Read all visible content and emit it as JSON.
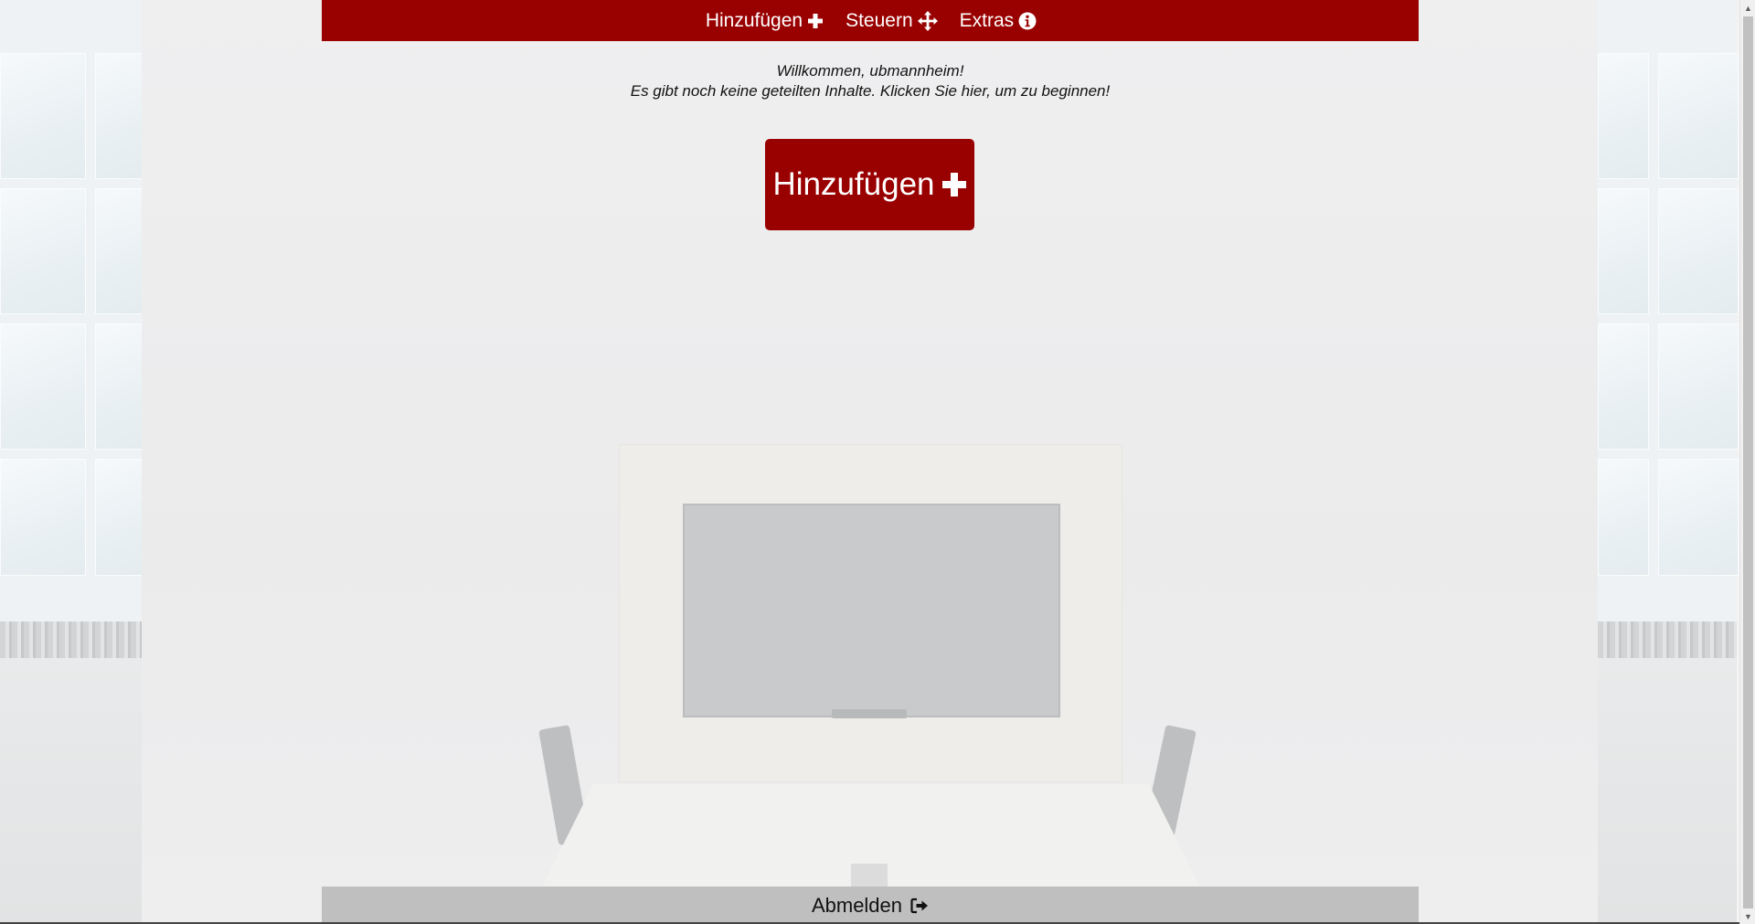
{
  "topnav": {
    "items": [
      {
        "label": "Hinzufügen",
        "icon": "plus-icon"
      },
      {
        "label": "Steuern",
        "icon": "move-arrows-icon"
      },
      {
        "label": "Extras",
        "icon": "info-circle-icon"
      }
    ]
  },
  "welcome": {
    "line1": "Willkommen, ubmannheim!",
    "line2": "Es gibt noch keine geteilten Inhalte. Klicken Sie hier, um zu beginnen!"
  },
  "add_button": {
    "label": "Hinzufügen",
    "icon": "plus-icon"
  },
  "footer": {
    "logout_label": "Abmelden",
    "logout_icon": "sign-out-icon"
  },
  "colors": {
    "brand": "#990000",
    "footer_bg": "#bfbfbf",
    "text_dark": "#111111"
  }
}
